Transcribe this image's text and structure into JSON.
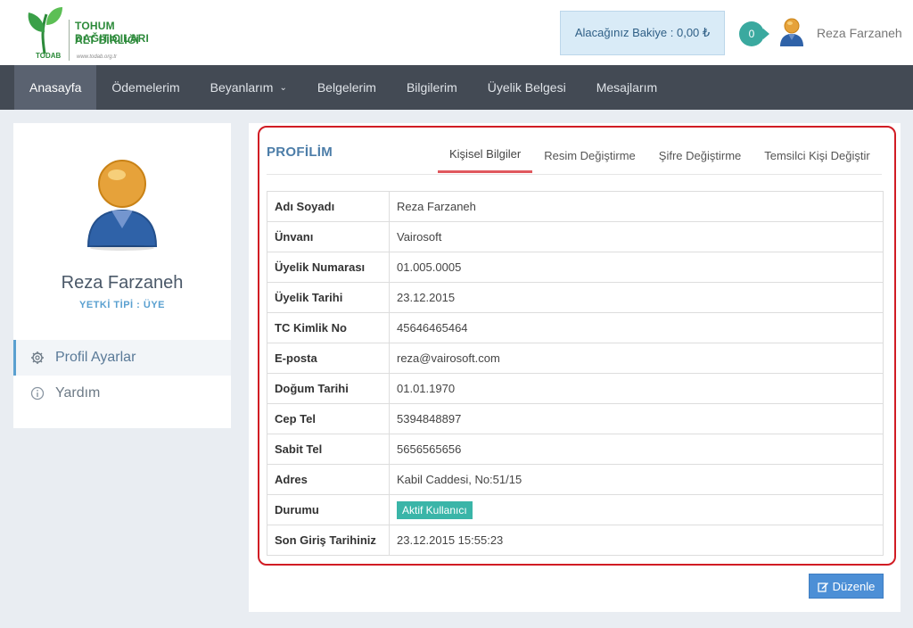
{
  "logo": {
    "line1": "TOHUM DAĞITICILARI",
    "line2": "ALT BİRLİĞİ",
    "short": "TODAB",
    "url": "www.todab.org.tr"
  },
  "header": {
    "balance": "Alacağınız Bakiye : 0,00 ₺",
    "notification_count": "0",
    "user_name": "Reza Farzaneh"
  },
  "nav": {
    "items": [
      {
        "label": "Anasayfa",
        "active": true
      },
      {
        "label": "Ödemelerim"
      },
      {
        "label": "Beyanlarım",
        "dropdown": true
      },
      {
        "label": "Belgelerim"
      },
      {
        "label": "Bilgilerim"
      },
      {
        "label": "Üyelik Belgesi"
      },
      {
        "label": "Mesajlarım"
      }
    ]
  },
  "sidebar": {
    "user_name": "Reza Farzaneh",
    "role": "YETKİ TİPİ : ÜYE",
    "menu": [
      {
        "label": "Profil Ayarlar",
        "icon": "gear-icon",
        "active": true
      },
      {
        "label": "Yardım",
        "icon": "info-icon"
      }
    ]
  },
  "profile": {
    "title": "PROFİLİM",
    "tabs": [
      {
        "label": "Kişisel Bilgiler",
        "active": true
      },
      {
        "label": "Resim Değiştirme"
      },
      {
        "label": "Şifre Değiştirme"
      },
      {
        "label": "Temsilci Kişi Değiştir"
      }
    ],
    "rows": [
      {
        "key": "Adı Soyadı",
        "value": "Reza Farzaneh"
      },
      {
        "key": "Ünvanı",
        "value": "Vairosoft"
      },
      {
        "key": "Üyelik Numarası",
        "value": "01.005.0005"
      },
      {
        "key": "Üyelik Tarihi",
        "value": "23.12.2015"
      },
      {
        "key": "TC Kimlik No",
        "value": "45646465464"
      },
      {
        "key": "E-posta",
        "value": "reza@vairosoft.com"
      },
      {
        "key": "Doğum Tarihi",
        "value": "01.01.1970"
      },
      {
        "key": "Cep Tel",
        "value": "5394848897"
      },
      {
        "key": "Sabit Tel",
        "value": "5656565656"
      },
      {
        "key": "Adres",
        "value": "Kabil Caddesi, No:51/15"
      },
      {
        "key": "Durumu",
        "value": "Aktif Kullanıcı",
        "badge": true
      },
      {
        "key": "Son Giriş Tarihiniz",
        "value": "23.12.2015 15:55:23"
      }
    ],
    "edit_label": "Düzenle"
  },
  "colors": {
    "nav_bg": "#434a54",
    "accent_blue": "#4c8fd6",
    "highlight_red": "#d11c24",
    "badge_teal": "#3ab5a8"
  }
}
